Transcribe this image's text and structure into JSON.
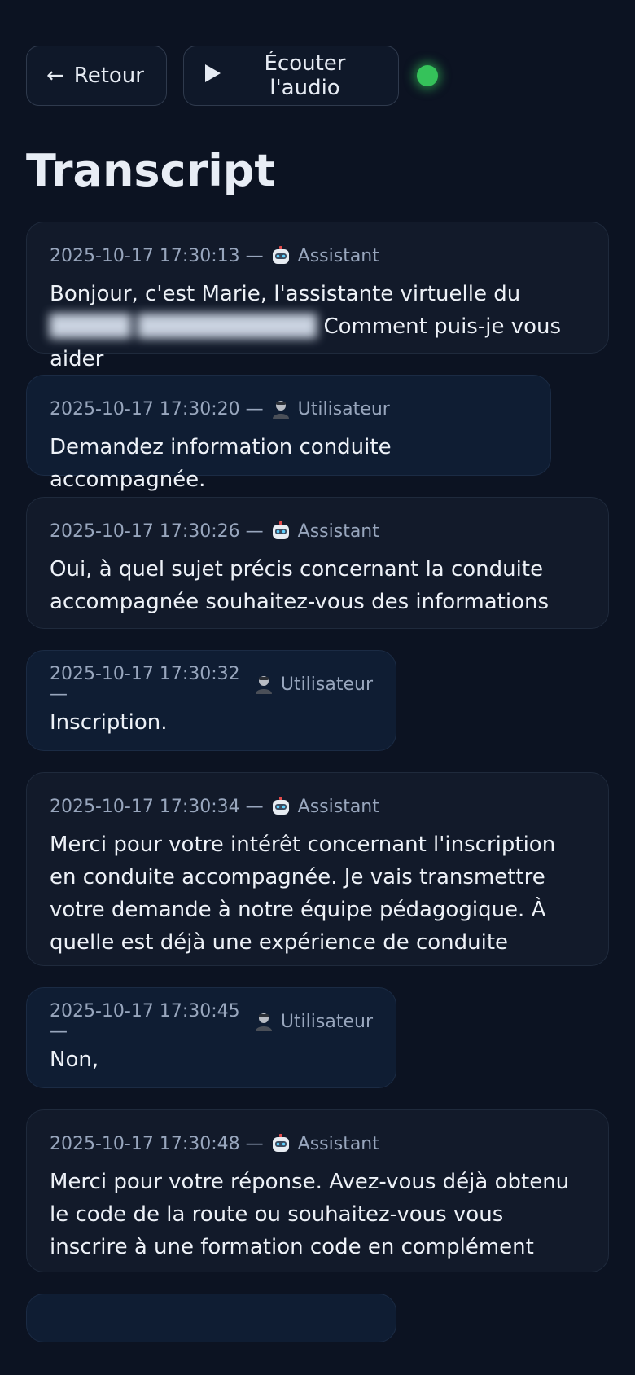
{
  "toolbar": {
    "back_label": "Retour",
    "back_icon": "arrow-left-icon",
    "audio_label": "Écouter l'audio",
    "audio_icon": "play-icon",
    "status_color": "#35c25a"
  },
  "page": {
    "title": "Transcript"
  },
  "messages": [
    {
      "timestamp": "2025-10-17 17:30:13 —",
      "role": "Assistant",
      "text": "Bonjour, c'est Marie, l'assistante virtuelle du",
      "text_tail": "Comment puis-je vous aider"
    },
    {
      "timestamp": "2025-10-17 17:30:20 —",
      "role": "Utilisateur",
      "text": "Demandez information conduite accompagnée."
    },
    {
      "timestamp": "2025-10-17 17:30:26 —",
      "role": "Assistant",
      "text": "Oui, à quel sujet précis concernant la conduite accompagnée souhaitez-vous des informations"
    },
    {
      "timestamp": "2025-10-17 17:30:32 —",
      "role": "Utilisateur",
      "text": "Inscription."
    },
    {
      "timestamp": "2025-10-17 17:30:34 —",
      "role": "Assistant",
      "text": "Merci pour votre intérêt concernant l'inscription en conduite accompagnée. Je vais transmettre votre demande à notre équipe pédagogique. À quelle est déjà une expérience de conduite"
    },
    {
      "timestamp": "2025-10-17 17:30:45 —",
      "role": "Utilisateur",
      "text": "Non,"
    },
    {
      "timestamp": "2025-10-17 17:30:48 —",
      "role": "Assistant",
      "text": "Merci pour votre réponse. Avez-vous déjà obtenu le code de la route ou souhaitez-vous vous inscrire à une formation code en complément"
    }
  ]
}
